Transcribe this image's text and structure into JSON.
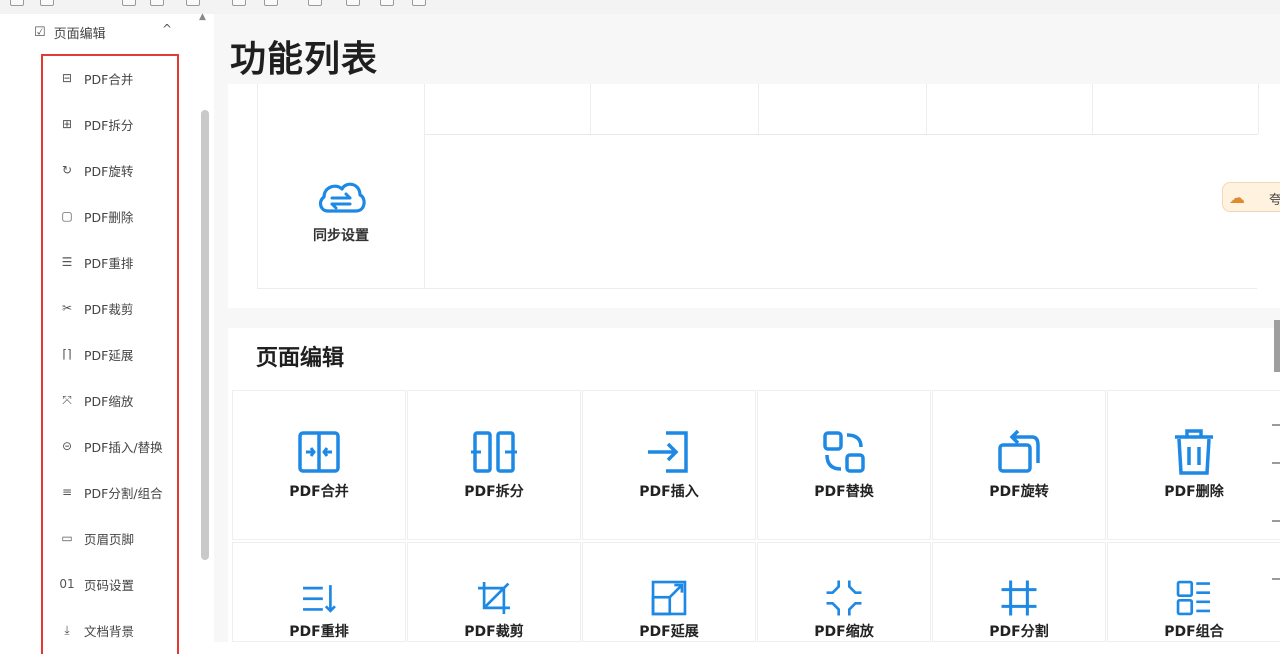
{
  "sidebar": {
    "header_label": "页面编辑",
    "items": [
      {
        "label": "PDF合并",
        "icon": "merge-icon"
      },
      {
        "label": "PDF拆分",
        "icon": "split-icon"
      },
      {
        "label": "PDF旋转",
        "icon": "rotate-icon"
      },
      {
        "label": "PDF删除",
        "icon": "delete-icon"
      },
      {
        "label": "PDF重排",
        "icon": "reorder-icon"
      },
      {
        "label": "PDF裁剪",
        "icon": "scissors-icon"
      },
      {
        "label": "PDF延展",
        "icon": "extend-icon"
      },
      {
        "label": "PDF缩放",
        "icon": "zoom-icon"
      },
      {
        "label": "PDF插入/替换",
        "icon": "insert-replace-icon"
      },
      {
        "label": "PDF分割/组合",
        "icon": "divide-combine-icon"
      },
      {
        "label": "页眉页脚",
        "icon": "header-footer-icon"
      },
      {
        "label": "页码设置",
        "icon": "page-number-icon"
      },
      {
        "label": "文档背景",
        "icon": "background-icon"
      }
    ]
  },
  "main": {
    "title": "功能列表",
    "sync": {
      "label": "同步设置",
      "icon": "cloud-sync-icon"
    },
    "section_title": "页面编辑",
    "tools_row1": [
      {
        "label": "PDF合并",
        "icon": "merge-icon"
      },
      {
        "label": "PDF拆分",
        "icon": "split-icon"
      },
      {
        "label": "PDF插入",
        "icon": "insert-icon"
      },
      {
        "label": "PDF替换",
        "icon": "replace-icon"
      },
      {
        "label": "PDF旋转",
        "icon": "rotate-icon"
      },
      {
        "label": "PDF删除",
        "icon": "trash-icon"
      }
    ],
    "tools_row2": [
      {
        "label": "PDF重排",
        "icon": "reorder-icon"
      },
      {
        "label": "PDF裁剪",
        "icon": "crop-icon"
      },
      {
        "label": "PDF延展",
        "icon": "extend-icon"
      },
      {
        "label": "PDF缩放",
        "icon": "zoom-icon"
      },
      {
        "label": "PDF分割",
        "icon": "divide-icon"
      },
      {
        "label": "PDF组合",
        "icon": "combine-icon"
      }
    ]
  },
  "float_button": {
    "label": "夸",
    "icon": "cloud-icon"
  },
  "colors": {
    "accent": "#1e88e5",
    "highlight": "#e53935",
    "float_bg": "#fff3e0"
  }
}
